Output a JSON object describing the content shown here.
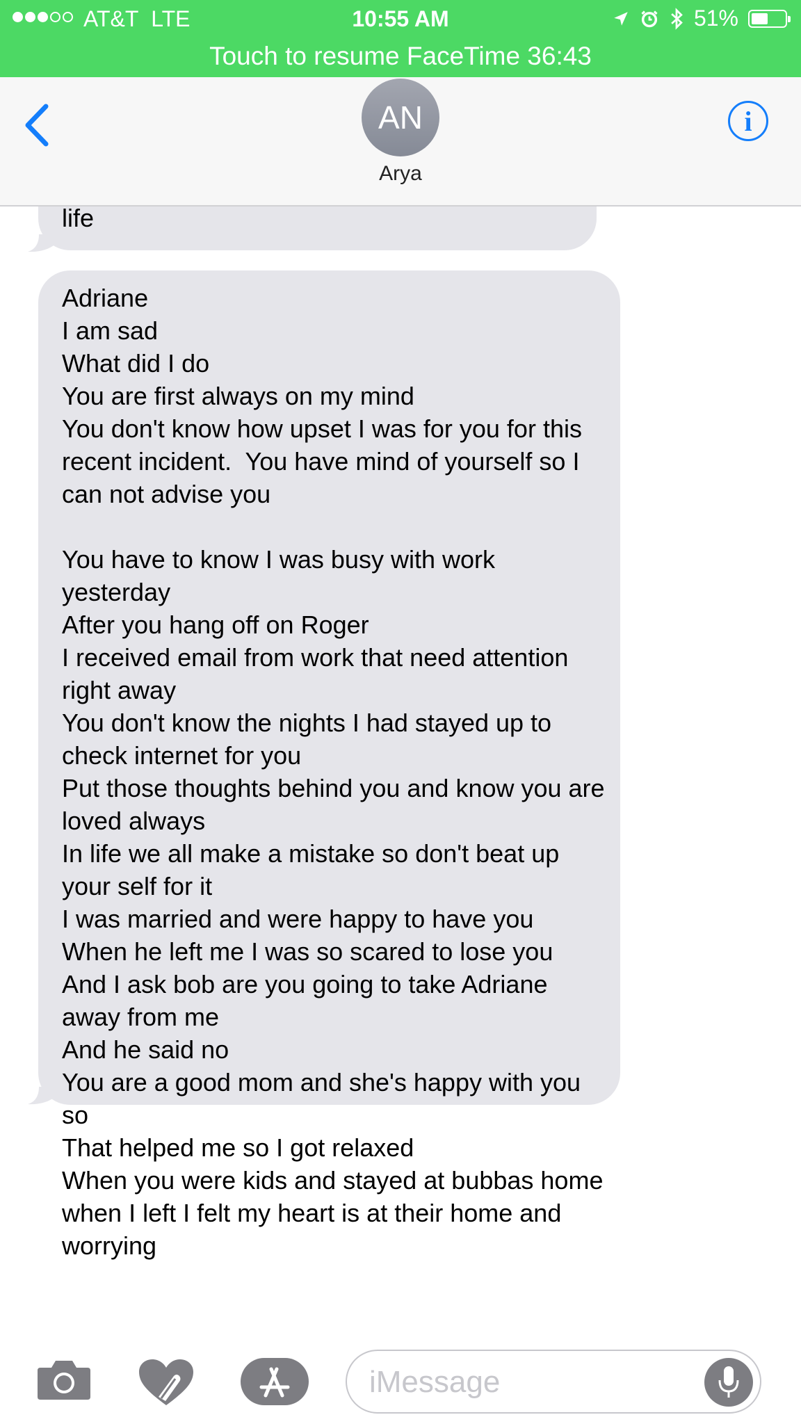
{
  "status_bar": {
    "carrier": "AT&T",
    "network": "LTE",
    "time": "10:55 AM",
    "battery": "51%",
    "battery_level": 0.51,
    "signal_bars_filled": 3,
    "signal_bars_total": 5
  },
  "banner": {
    "text": "Touch to resume FaceTime 36:43"
  },
  "header": {
    "avatar_initials": "AN",
    "contact_name": "Arya"
  },
  "messages": [
    {
      "direction": "incoming",
      "text": "life"
    },
    {
      "direction": "incoming",
      "text": "Adriane\nI am sad\nWhat did I do\nYou are first always on my mind\nYou don't know how upset I was for you for this recent incident.  You have mind of yourself so I can not advise you\n\nYou have to know I was busy with work yesterday\nAfter you hang off on Roger\nI received email from work that need attention right away\nYou don't know the nights I had stayed up to check internet for you\nPut those thoughts behind you and know you are loved always\nIn life we all make a mistake so don't beat up your self for it\nI was married and were happy to have you\nWhen he left me I was so scared to lose you\nAnd I ask bob are you going to take Adriane away from me\nAnd he said no\nYou are a good mom and she's happy with you so\nThat helped me so I got relaxed\nWhen you were kids and stayed at bubbas home when I left I felt my heart is at their home and worrying"
    }
  ],
  "input": {
    "placeholder": "iMessage"
  },
  "icons": {
    "back": "chevron-left-icon",
    "info": "info-icon",
    "camera": "camera-icon",
    "digital_touch": "heart-hand-icon",
    "app_store": "app-store-icon",
    "mic": "microphone-icon"
  },
  "colors": {
    "banner_green": "#4cd964",
    "accent_blue": "#147efb",
    "bubble_gray": "#e5e5ea",
    "tool_gray": "#7d7d82"
  }
}
